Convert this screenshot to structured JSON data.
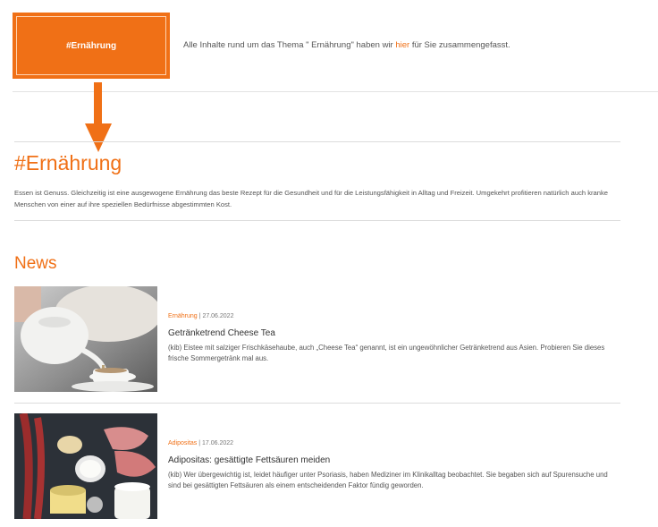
{
  "badge": {
    "label": "#Ernährung"
  },
  "intro": {
    "before": "Alle Inhalte rund um das Thema \" Ernährung\" haben wir ",
    "link": "hier",
    "after": " für Sie zusammengefasst."
  },
  "topic": {
    "title": "#Ernährung",
    "description": "Essen ist Genuss. Gleichzeitig ist eine ausgewogene Ernährung das beste Rezept für die Gesundheit und für die Leistungsfähigkeit in Alltag und Freizeit. Umgekehrt profitieren natürlich auch kranke Menschen von einer auf ihre speziellen Bedürfnisse abgestimmten Kost."
  },
  "news": {
    "heading": "News",
    "articles": [
      {
        "category": "Ernährung",
        "separator": "|",
        "date": "27.06.2022",
        "title": "Getränketrend Cheese Tea",
        "summary": "(kib) Eistee mit salziger Frischkäsehaube, auch „Cheese Tea“ genannt, ist ein ungewöhnlicher Getränketrend aus Asien. Probieren Sie dieses frische Sommergetränk mal aus.",
        "image": "tea-pouring-photo"
      },
      {
        "category": "Adipositas",
        "separator": "|",
        "date": "17.06.2022",
        "title": "Adipositas: gesättigte Fettsäuren meiden",
        "summary": "(kib) Wer übergewichtig ist, leidet häufiger unter Psoriasis, haben Mediziner im Klinikalltag beobachtet. Sie begaben sich auf Spurensuche und sind bei gesättigten Fettsäuren als einem entscheidenden Faktor fündig geworden.",
        "image": "meat-dairy-photo"
      }
    ]
  },
  "colors": {
    "accent": "#f07016",
    "text": "#555555",
    "divider": "#dcdcdc"
  }
}
